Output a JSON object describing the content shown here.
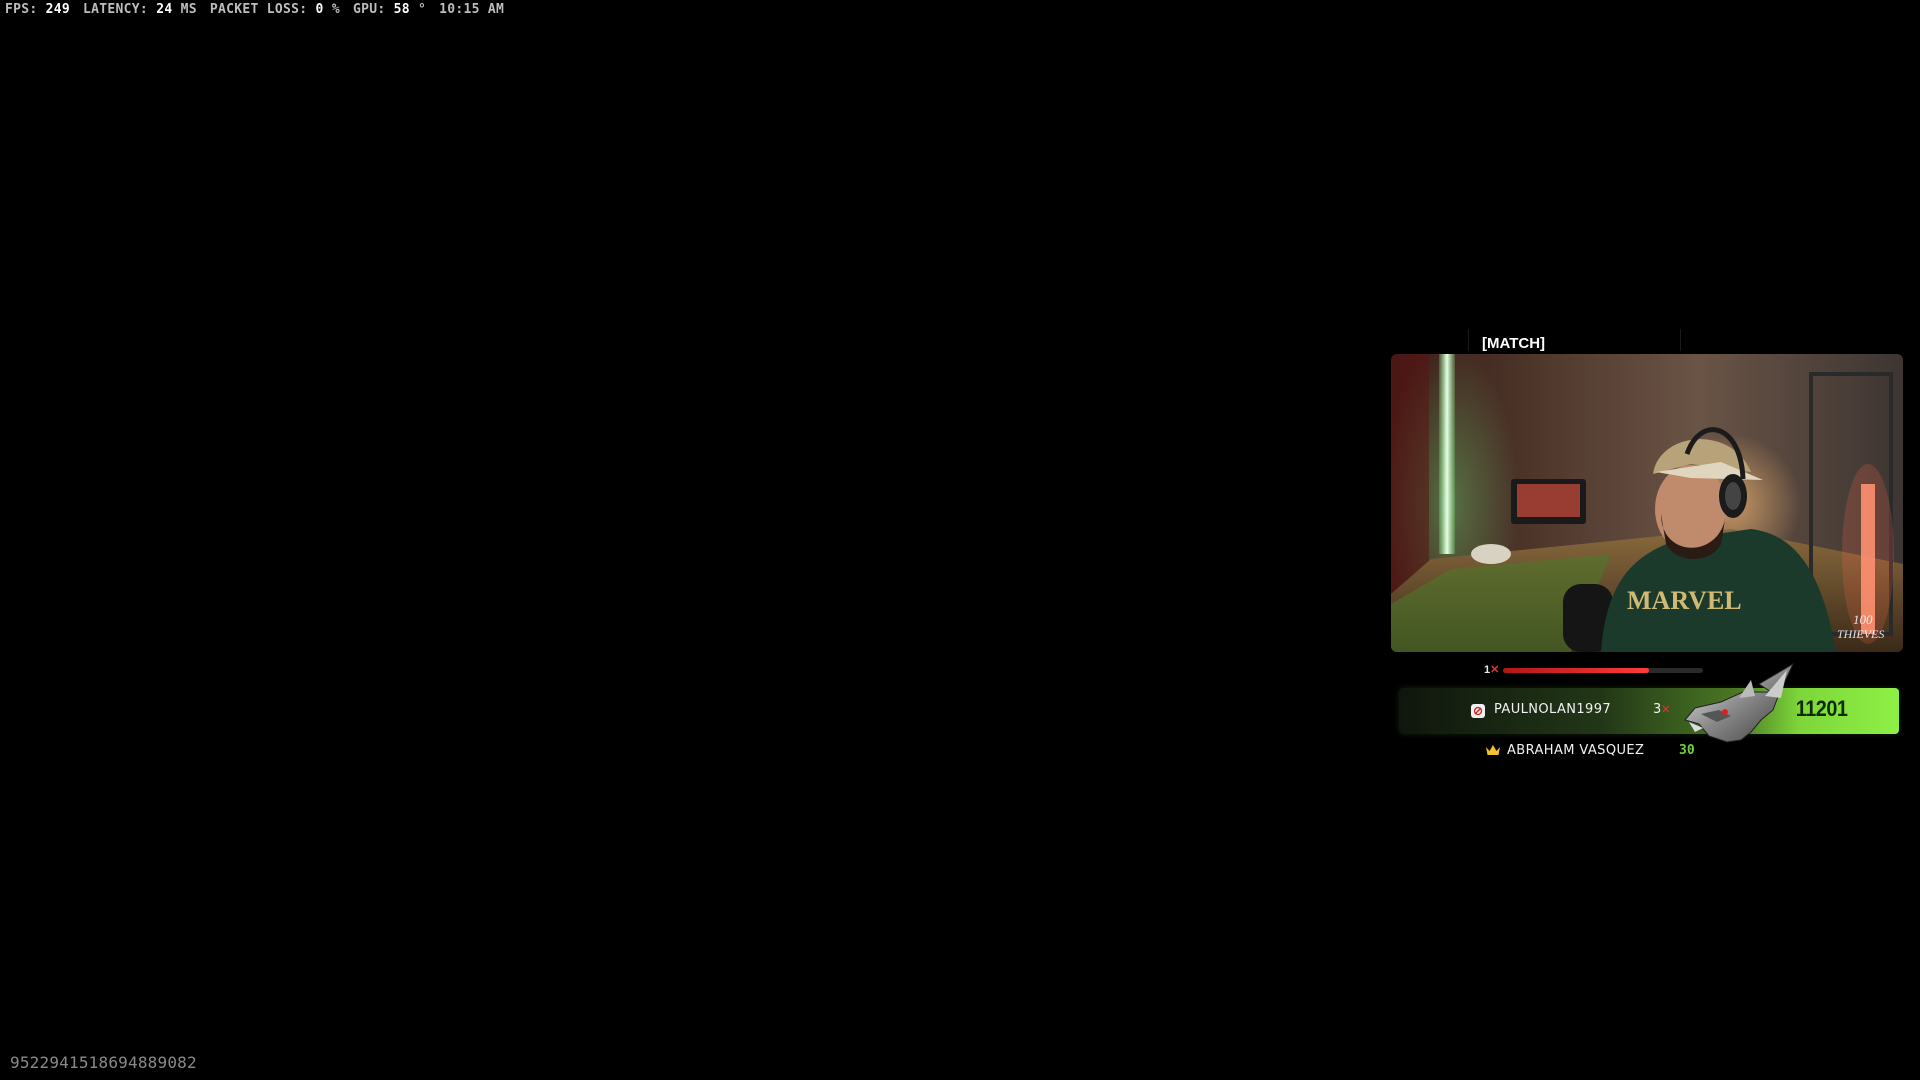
{
  "stats": {
    "fps_label": "FPS:",
    "fps_value": "249",
    "latency_label": "LATENCY:",
    "latency_value": "24",
    "latency_unit": "MS",
    "packet_loss_label": "PACKET LOSS:",
    "packet_loss_value": "0",
    "packet_loss_unit": "%",
    "gpu_label": "GPU:",
    "gpu_value": "58",
    "gpu_unit": "°",
    "clock": "10:15 AM"
  },
  "match": {
    "label": "[MATCH]"
  },
  "webcam": {
    "watermark_text": "100 THIEVES",
    "shirt_text": "MARVEL"
  },
  "multiplier": {
    "value": "1",
    "symbol": "✕",
    "progress": 0.73
  },
  "player": {
    "name": "PAULNOLAN1997",
    "kills": "3",
    "kills_symbol": "✕",
    "score": "11201",
    "icon": "player-badge-icon",
    "emblem": "dragon-rank-emblem"
  },
  "leader": {
    "icon": "crown-icon",
    "name": "ABRAHAM VASQUEZ",
    "score": "30"
  },
  "session_id": "95229415186948890​82",
  "colors": {
    "accent_green": "#8ef045",
    "score_text": "#0f2a07",
    "danger_red": "#e53535",
    "leader_score": "#6dd13a"
  }
}
